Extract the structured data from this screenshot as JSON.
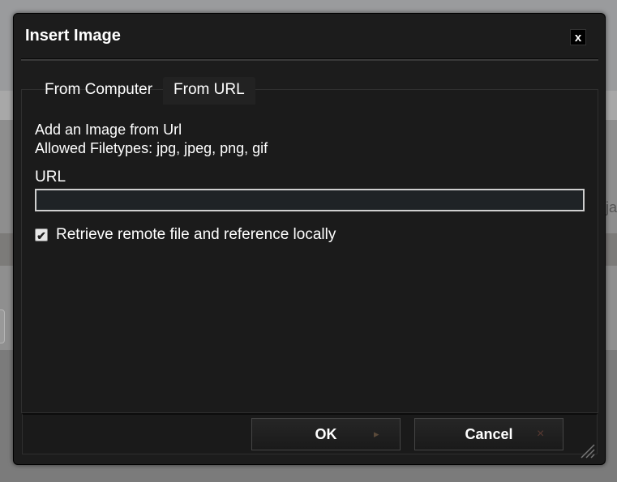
{
  "background": {
    "partial_text": "ja"
  },
  "dialog": {
    "title": "Insert Image",
    "close_label": "x",
    "tabs": [
      {
        "label": "From Computer",
        "active": false
      },
      {
        "label": "From URL",
        "active": true
      }
    ],
    "description_line1": "Add an Image from Url",
    "description_line2": "Allowed Filetypes: jpg, jpeg, png, gif",
    "url_label": "URL",
    "url_value": "",
    "checkbox_label": "Retrieve remote file and reference locally",
    "checkbox_checked": true,
    "checkbox_mark": "✔",
    "ok_label": "OK",
    "ok_icon": "▸",
    "cancel_label": "Cancel",
    "cancel_icon": "×"
  },
  "colors": {
    "dialog_bg": "#1c1c1c",
    "text": "#ffffff",
    "input_border": "#cfcfcf"
  }
}
